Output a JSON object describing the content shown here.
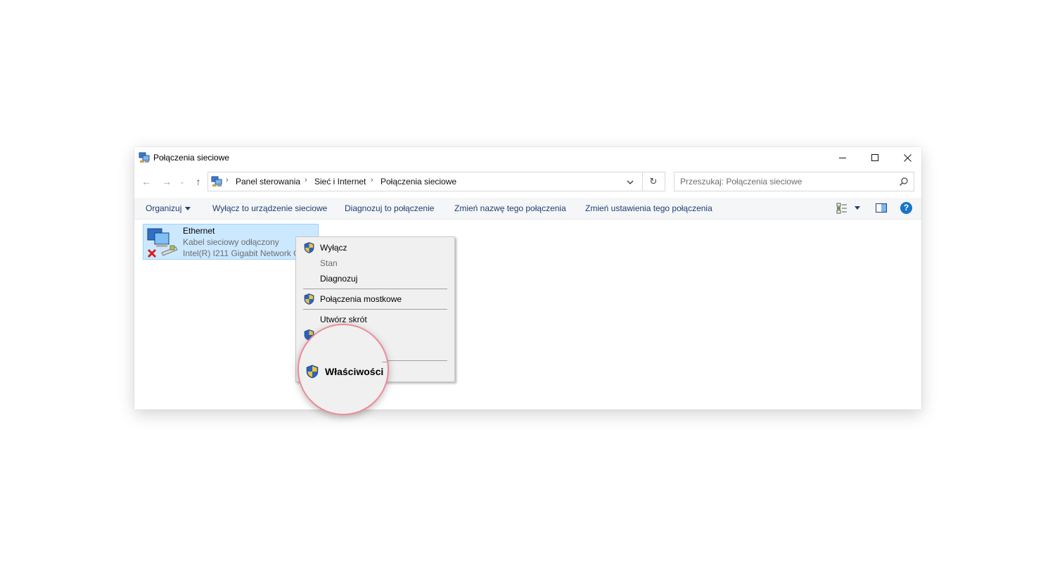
{
  "window": {
    "title": "Połączenia sieciowe",
    "controls": {
      "minimize": "minimize-icon",
      "maximize": "maximize-icon",
      "close": "close-icon"
    }
  },
  "nav": {
    "back_icon": "←",
    "forward_icon": "→",
    "recent_icon": "⌄",
    "up_icon": "↑",
    "breadcrumb": [
      "Panel sterowania",
      "Sieć i Internet",
      "Połączenia sieciowe"
    ],
    "refresh_icon": "↻",
    "search_placeholder": "Przeszukaj: Połączenia sieciowe"
  },
  "toolbar": {
    "organize": "Organizuj",
    "disable": "Wyłącz to urządzenie sieciowe",
    "diagnose": "Diagnozuj to połączenie",
    "rename": "Zmień nazwę tego połączenia",
    "change_settings": "Zmień ustawienia tego połączenia",
    "help": "?"
  },
  "connection": {
    "name": "Ethernet",
    "status": "Kabel sieciowy odłączony",
    "adapter": "Intel(R) I211 Gigabit Network C"
  },
  "context_menu": {
    "items": [
      {
        "label": "Wyłącz",
        "shield": true,
        "disabled": false
      },
      {
        "label": "Stan",
        "shield": false,
        "disabled": true
      },
      {
        "label": "Diagnozuj",
        "shield": false,
        "disabled": false
      },
      {
        "label": "Połączenia mostkowe",
        "shield": true,
        "disabled": false
      },
      {
        "label": "Utwórz skrót",
        "shield": false,
        "disabled": false
      }
    ],
    "magnified_item": "Właściwości"
  },
  "colors": {
    "selection_bg": "#cce8ff",
    "selection_border": "#99d1ff",
    "command_text": "#1e3e74",
    "help_blue": "#1a73c9",
    "magnifier_ring": "#ef8a96"
  }
}
